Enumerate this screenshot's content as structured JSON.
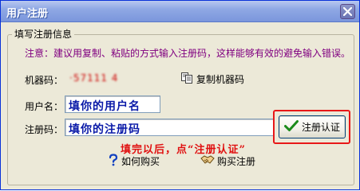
{
  "window": {
    "title": "用户注册"
  },
  "group": {
    "legend": "填写注册信息",
    "notice": "注意：建议用复制、粘贴的方式输入注册码，这样能够有效的避免输入错误。"
  },
  "form": {
    "machine_code_label": "机器码：",
    "machine_code_value": "·57111 4",
    "copy_machine_code_label": "复制机器码",
    "username_label": "用户名：",
    "username_value": "填你的用户名",
    "regcode_label": "注册码：",
    "regcode_value": "填你的注册码",
    "register_button_label": "注册认证"
  },
  "hint": {
    "text": "填完以后，点“注册认证”"
  },
  "links": {
    "how_to_buy": "如何购买",
    "buy_register": "购买注册"
  },
  "colors": {
    "notice": "#800080",
    "hint": "#e01010",
    "highlight_border": "#e81818",
    "input_text": "#0a1aa8"
  }
}
